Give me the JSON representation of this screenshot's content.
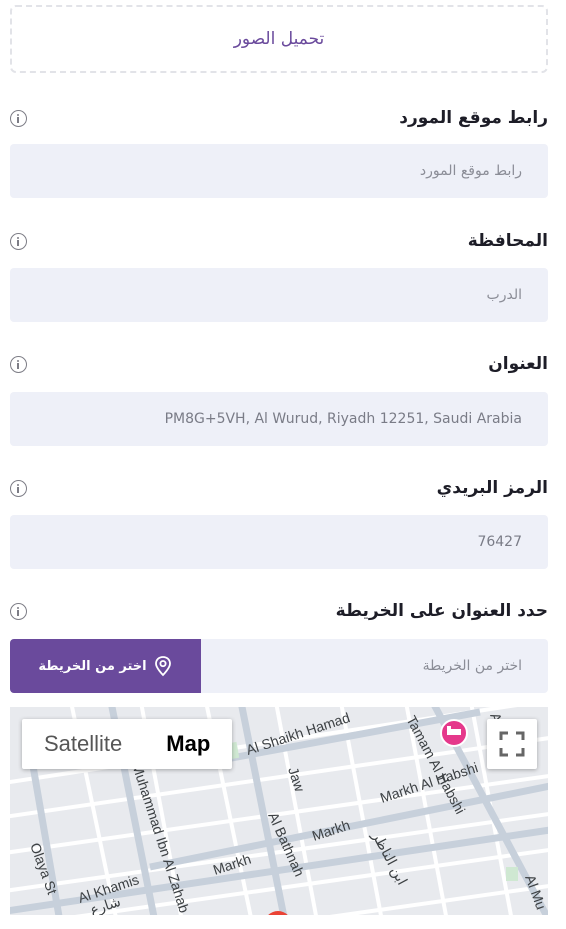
{
  "upload": {
    "label": "تحميل الصور"
  },
  "fields": [
    {
      "label": "رابط موقع المورد",
      "placeholder": "رابط موقع المورد",
      "value": ""
    },
    {
      "label": "المحافظة",
      "placeholder": "الدرب",
      "value": ""
    },
    {
      "label": "العنوان",
      "placeholder": "",
      "value": "PM8G+5VH, Al Wurud, Riyadh 12251, Saudi Arabia"
    },
    {
      "label": "الرمز البريدي",
      "placeholder": "",
      "value": "76427"
    }
  ],
  "map_section": {
    "label": "حدد العنوان على الخريطة",
    "placeholder": "اختر من الخريطة",
    "button_label": "اختر من الخريطة"
  },
  "map": {
    "satellite_label": "Satellite",
    "map_label": "Map",
    "streets": {
      "shaikh": "Al Shaikh Hamad",
      "tamam": "Tamam Al Habshi",
      "jaw": "Jaw",
      "markh1": "Markh Al Habshi",
      "muhammad": "Muhammad Ibn Al Zahab",
      "bathnah": "Al Bathnah",
      "markh2": "Markh",
      "markh3": "Markh",
      "olaya": "Olaya St",
      "khamis": "Al Khamis",
      "arabic1": "ابن الناظر",
      "arabic2": "شارع",
      "edge1": "Al Mu",
      "edge2": "Al Ark"
    }
  },
  "colors": {
    "accent": "#6a4a9c",
    "input_bg": "#eef0f8",
    "hotel_pin": "#e5388b"
  },
  "icons": {
    "info": "info-icon",
    "location": "location-pin-icon",
    "fullscreen": "fullscreen-icon"
  }
}
